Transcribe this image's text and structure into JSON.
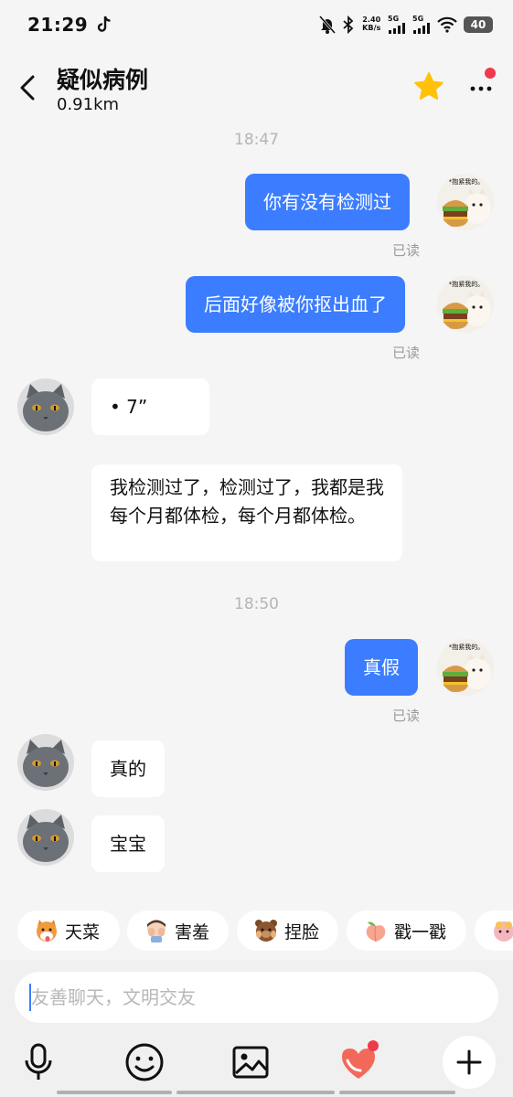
{
  "status_bar": {
    "time": "21:29",
    "net_speed_value": "2.40",
    "net_speed_unit": "KB/s",
    "sim1": "5G",
    "sim2": "5G",
    "battery": "40"
  },
  "header": {
    "title": "疑似病例",
    "distance": "0.91km"
  },
  "avatar_caption": "*抱紧我的。",
  "messages": [
    {
      "type": "time",
      "text": "18:47"
    },
    {
      "type": "sent",
      "text": "你有没有检测过",
      "status": "已读"
    },
    {
      "type": "sent",
      "text": "后面好像被你抠出血了",
      "status": "已读"
    },
    {
      "type": "received",
      "text": "•     7”"
    },
    {
      "type": "received",
      "text": "我检测过了，检测过了，我都是我每个月都体检，每个月都体检。"
    },
    {
      "type": "time",
      "text": "18:50"
    },
    {
      "type": "sent",
      "text": "真假",
      "status": "已读"
    },
    {
      "type": "received",
      "text": "真的"
    },
    {
      "type": "received",
      "text": "宝宝"
    }
  ],
  "quick_replies": [
    "天菜",
    "害羞",
    "捏脸",
    "戳一戳"
  ],
  "input": {
    "placeholder": "友善聊天，文明交友",
    "value": ""
  },
  "toolbar": [
    "mic-icon",
    "emoji-icon",
    "image-icon",
    "heart-gift-icon",
    "plus-icon"
  ],
  "colors": {
    "accent": "#3c7dff",
    "badge": "#f0394d",
    "background": "#f5f5f5"
  }
}
